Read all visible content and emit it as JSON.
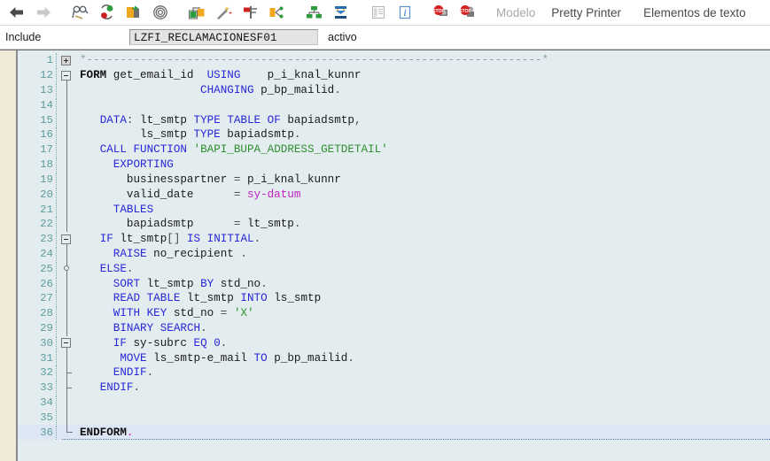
{
  "toolbar": {
    "icons": [
      {
        "name": "back-arrow-icon",
        "glyph": "back"
      },
      {
        "name": "forward-arrow-icon",
        "glyph": "forward"
      },
      {
        "name": "display-object-list-icon",
        "glyph": "glasses"
      },
      {
        "name": "check-syntax-icon",
        "glyph": "redgreen"
      },
      {
        "name": "activate-icon",
        "glyph": "yellowgray"
      },
      {
        "name": "pattern-icon",
        "glyph": "spiral"
      },
      {
        "name": "where-used-icon",
        "glyph": "blocks"
      },
      {
        "name": "pattern-wand-icon",
        "glyph": "wand"
      },
      {
        "name": "pretty-printer-icon",
        "glyph": "redflag"
      },
      {
        "name": "compare-icon",
        "glyph": "yellowsplit"
      },
      {
        "name": "object-navigator-icon",
        "glyph": "greentree"
      },
      {
        "name": "enhancement-icon",
        "glyph": "bluestack"
      },
      {
        "name": "documentation-icon",
        "glyph": "doc"
      },
      {
        "name": "info-icon",
        "glyph": "info"
      },
      {
        "name": "breakpoint-icon",
        "glyph": "redstop1"
      },
      {
        "name": "watchpoint-icon",
        "glyph": "redstop2"
      }
    ],
    "buttons": [
      {
        "name": "modelo-button",
        "label": "Modelo",
        "enabled": false
      },
      {
        "name": "pretty-printer-button",
        "label": "Pretty Printer",
        "enabled": true
      },
      {
        "name": "elementos-de-texto-button",
        "label": "Elementos de texto",
        "enabled": true
      }
    ]
  },
  "header": {
    "object_type_label": "Include",
    "object_name": "LZFI_RECLAMACIONESF01",
    "status": "activo"
  },
  "editor": {
    "current_line": 36,
    "lines": [
      {
        "num": 1,
        "fold": "plus",
        "tokens": [
          {
            "t": "*--------------------------------------------------------------------*",
            "c": "cmt"
          }
        ]
      },
      {
        "num": 12,
        "fold": "minus",
        "tokens": [
          {
            "t": "FORM",
            "c": "form"
          },
          {
            "t": " ",
            "c": "id"
          },
          {
            "t": "get_email_id",
            "c": "id"
          },
          {
            "t": "  ",
            "c": "id"
          },
          {
            "t": "USING",
            "c": "kw"
          },
          {
            "t": "    ",
            "c": "id"
          },
          {
            "t": "p_i_knal_kunnr",
            "c": "id"
          }
        ]
      },
      {
        "num": 13,
        "fold": "vline",
        "tokens": [
          {
            "t": "                  ",
            "c": "id"
          },
          {
            "t": "CHANGING",
            "c": "kw"
          },
          {
            "t": " ",
            "c": "id"
          },
          {
            "t": "p_bp_mailid",
            "c": "id"
          },
          {
            "t": ".",
            "c": "pun"
          }
        ]
      },
      {
        "num": 14,
        "fold": "vline",
        "tokens": []
      },
      {
        "num": 15,
        "fold": "vline",
        "tokens": [
          {
            "t": "   ",
            "c": "id"
          },
          {
            "t": "DATA",
            "c": "kw"
          },
          {
            "t": ": ",
            "c": "pun"
          },
          {
            "t": "lt_smtp",
            "c": "id"
          },
          {
            "t": " ",
            "c": "id"
          },
          {
            "t": "TYPE",
            "c": "kw"
          },
          {
            "t": " ",
            "c": "id"
          },
          {
            "t": "TABLE",
            "c": "kw"
          },
          {
            "t": " ",
            "c": "id"
          },
          {
            "t": "OF",
            "c": "kw"
          },
          {
            "t": " ",
            "c": "id"
          },
          {
            "t": "bapiadsmtp",
            "c": "id"
          },
          {
            "t": ",",
            "c": "pun"
          }
        ]
      },
      {
        "num": 16,
        "fold": "vline",
        "tokens": [
          {
            "t": "         ",
            "c": "id"
          },
          {
            "t": "ls_smtp",
            "c": "id"
          },
          {
            "t": " ",
            "c": "id"
          },
          {
            "t": "TYPE",
            "c": "kw"
          },
          {
            "t": " ",
            "c": "id"
          },
          {
            "t": "bapiadsmtp",
            "c": "id"
          },
          {
            "t": ".",
            "c": "pun"
          }
        ]
      },
      {
        "num": 17,
        "fold": "vline",
        "tokens": [
          {
            "t": "   ",
            "c": "id"
          },
          {
            "t": "CALL",
            "c": "kw"
          },
          {
            "t": " ",
            "c": "id"
          },
          {
            "t": "FUNCTION",
            "c": "kw"
          },
          {
            "t": " ",
            "c": "id"
          },
          {
            "t": "'BAPI_BUPA_ADDRESS_GETDETAIL'",
            "c": "str"
          }
        ]
      },
      {
        "num": 18,
        "fold": "vline",
        "tokens": [
          {
            "t": "     ",
            "c": "id"
          },
          {
            "t": "EXPORTING",
            "c": "kw"
          }
        ]
      },
      {
        "num": 19,
        "fold": "vline",
        "tokens": [
          {
            "t": "       ",
            "c": "id"
          },
          {
            "t": "businesspartner",
            "c": "id"
          },
          {
            "t": " = ",
            "c": "pun"
          },
          {
            "t": "p_i_knal_kunnr",
            "c": "id"
          }
        ]
      },
      {
        "num": 20,
        "fold": "vline",
        "tokens": [
          {
            "t": "       ",
            "c": "id"
          },
          {
            "t": "valid_date",
            "c": "id"
          },
          {
            "t": "      = ",
            "c": "pun"
          },
          {
            "t": "sy-datum",
            "c": "sys"
          }
        ]
      },
      {
        "num": 21,
        "fold": "vline",
        "tokens": [
          {
            "t": "     ",
            "c": "id"
          },
          {
            "t": "TABLES",
            "c": "kw"
          }
        ]
      },
      {
        "num": 22,
        "fold": "vline",
        "tokens": [
          {
            "t": "       ",
            "c": "id"
          },
          {
            "t": "bapiadsmtp",
            "c": "id"
          },
          {
            "t": "      = ",
            "c": "pun"
          },
          {
            "t": "lt_smtp",
            "c": "id"
          },
          {
            "t": ".",
            "c": "pun"
          }
        ]
      },
      {
        "num": 23,
        "fold": "minus",
        "tokens": [
          {
            "t": "   ",
            "c": "id"
          },
          {
            "t": "IF",
            "c": "kw"
          },
          {
            "t": " ",
            "c": "id"
          },
          {
            "t": "lt_smtp",
            "c": "id"
          },
          {
            "t": "[]",
            "c": "pun"
          },
          {
            "t": " ",
            "c": "id"
          },
          {
            "t": "IS",
            "c": "kw"
          },
          {
            "t": " ",
            "c": "id"
          },
          {
            "t": "INITIAL",
            "c": "kw"
          },
          {
            "t": ".",
            "c": "pun"
          }
        ]
      },
      {
        "num": 24,
        "fold": "vline",
        "tokens": [
          {
            "t": "     ",
            "c": "id"
          },
          {
            "t": "RAISE",
            "c": "kw"
          },
          {
            "t": " ",
            "c": "id"
          },
          {
            "t": "no_recipient",
            "c": "id"
          },
          {
            "t": " .",
            "c": "pun"
          }
        ]
      },
      {
        "num": 25,
        "fold": "dot",
        "tokens": [
          {
            "t": "   ",
            "c": "id"
          },
          {
            "t": "ELSE",
            "c": "kw"
          },
          {
            "t": ".",
            "c": "pun"
          }
        ]
      },
      {
        "num": 26,
        "fold": "vline",
        "tokens": [
          {
            "t": "     ",
            "c": "id"
          },
          {
            "t": "SORT",
            "c": "kw"
          },
          {
            "t": " ",
            "c": "id"
          },
          {
            "t": "lt_smtp",
            "c": "id"
          },
          {
            "t": " ",
            "c": "id"
          },
          {
            "t": "BY",
            "c": "kw"
          },
          {
            "t": " ",
            "c": "id"
          },
          {
            "t": "std_no",
            "c": "id"
          },
          {
            "t": ".",
            "c": "pun"
          }
        ]
      },
      {
        "num": 27,
        "fold": "vline",
        "tokens": [
          {
            "t": "     ",
            "c": "id"
          },
          {
            "t": "READ",
            "c": "kw"
          },
          {
            "t": " ",
            "c": "id"
          },
          {
            "t": "TABLE",
            "c": "kw"
          },
          {
            "t": " ",
            "c": "id"
          },
          {
            "t": "lt_smtp",
            "c": "id"
          },
          {
            "t": " ",
            "c": "id"
          },
          {
            "t": "INTO",
            "c": "kw"
          },
          {
            "t": " ",
            "c": "id"
          },
          {
            "t": "ls_smtp",
            "c": "id"
          }
        ]
      },
      {
        "num": 28,
        "fold": "vline",
        "tokens": [
          {
            "t": "     ",
            "c": "id"
          },
          {
            "t": "WITH",
            "c": "kw"
          },
          {
            "t": " ",
            "c": "id"
          },
          {
            "t": "KEY",
            "c": "kw"
          },
          {
            "t": " ",
            "c": "id"
          },
          {
            "t": "std_no",
            "c": "id"
          },
          {
            "t": " = ",
            "c": "pun"
          },
          {
            "t": "'X'",
            "c": "str"
          }
        ]
      },
      {
        "num": 29,
        "fold": "vline",
        "tokens": [
          {
            "t": "     ",
            "c": "id"
          },
          {
            "t": "BINARY",
            "c": "kw"
          },
          {
            "t": " ",
            "c": "id"
          },
          {
            "t": "SEARCH",
            "c": "kw"
          },
          {
            "t": ".",
            "c": "pun"
          }
        ]
      },
      {
        "num": 30,
        "fold": "minus",
        "tokens": [
          {
            "t": "     ",
            "c": "id"
          },
          {
            "t": "IF",
            "c": "kw"
          },
          {
            "t": " ",
            "c": "id"
          },
          {
            "t": "sy-subrc",
            "c": "id"
          },
          {
            "t": " ",
            "c": "id"
          },
          {
            "t": "EQ",
            "c": "kw"
          },
          {
            "t": " ",
            "c": "id"
          },
          {
            "t": "0",
            "c": "num"
          },
          {
            "t": ".",
            "c": "pun"
          }
        ]
      },
      {
        "num": 31,
        "fold": "vline",
        "tokens": [
          {
            "t": "      ",
            "c": "id"
          },
          {
            "t": "MOVE",
            "c": "kw"
          },
          {
            "t": " ",
            "c": "id"
          },
          {
            "t": "ls_smtp-e_mail",
            "c": "id"
          },
          {
            "t": " ",
            "c": "id"
          },
          {
            "t": "TO",
            "c": "kw"
          },
          {
            "t": " ",
            "c": "id"
          },
          {
            "t": "p_bp_mailid",
            "c": "id"
          },
          {
            "t": ".",
            "c": "pun"
          }
        ]
      },
      {
        "num": 32,
        "fold": "tick",
        "tokens": [
          {
            "t": "     ",
            "c": "id"
          },
          {
            "t": "ENDIF",
            "c": "kw"
          },
          {
            "t": ".",
            "c": "pun"
          }
        ]
      },
      {
        "num": 33,
        "fold": "tick",
        "tokens": [
          {
            "t": "   ",
            "c": "id"
          },
          {
            "t": "ENDIF",
            "c": "kw"
          },
          {
            "t": ".",
            "c": "pun"
          }
        ]
      },
      {
        "num": 34,
        "fold": "vline",
        "tokens": []
      },
      {
        "num": 35,
        "fold": "vline",
        "tokens": []
      },
      {
        "num": 36,
        "fold": "elbow",
        "tokens": [
          {
            "t": "ENDFORM",
            "c": "form"
          },
          {
            "t": ".",
            "c": "dot-m"
          }
        ]
      }
    ]
  }
}
